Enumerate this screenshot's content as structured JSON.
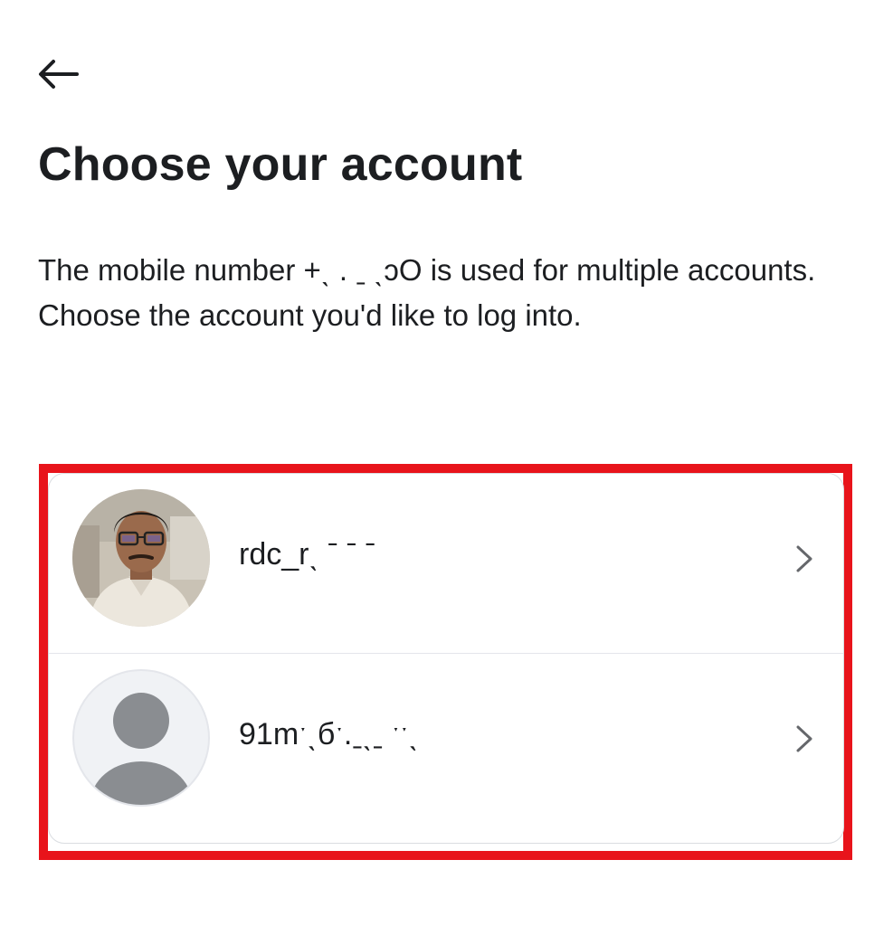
{
  "header": {
    "back_icon": "arrow-left-icon"
  },
  "page": {
    "title": "Choose your account",
    "description": "The mobile number +ˎ  . ˍ               ˎↄO is used for multiple accounts. Choose the account you'd like to log into."
  },
  "accounts": [
    {
      "username": "rdc_rˎ  ˉ  ˉ   ˉ",
      "avatar": "profile-photo",
      "chevron_icon": "chevron-right-icon"
    },
    {
      "username": "91mˑˎбˑ.ˍˎˍ    ˑˑˎ",
      "avatar": "default-avatar-icon",
      "chevron_icon": "chevron-right-icon"
    }
  ],
  "colors": {
    "highlight_border": "#e8141b",
    "text": "#1c1e21",
    "divider": "#e4e6eb",
    "default_avatar": "#8a8d91"
  }
}
